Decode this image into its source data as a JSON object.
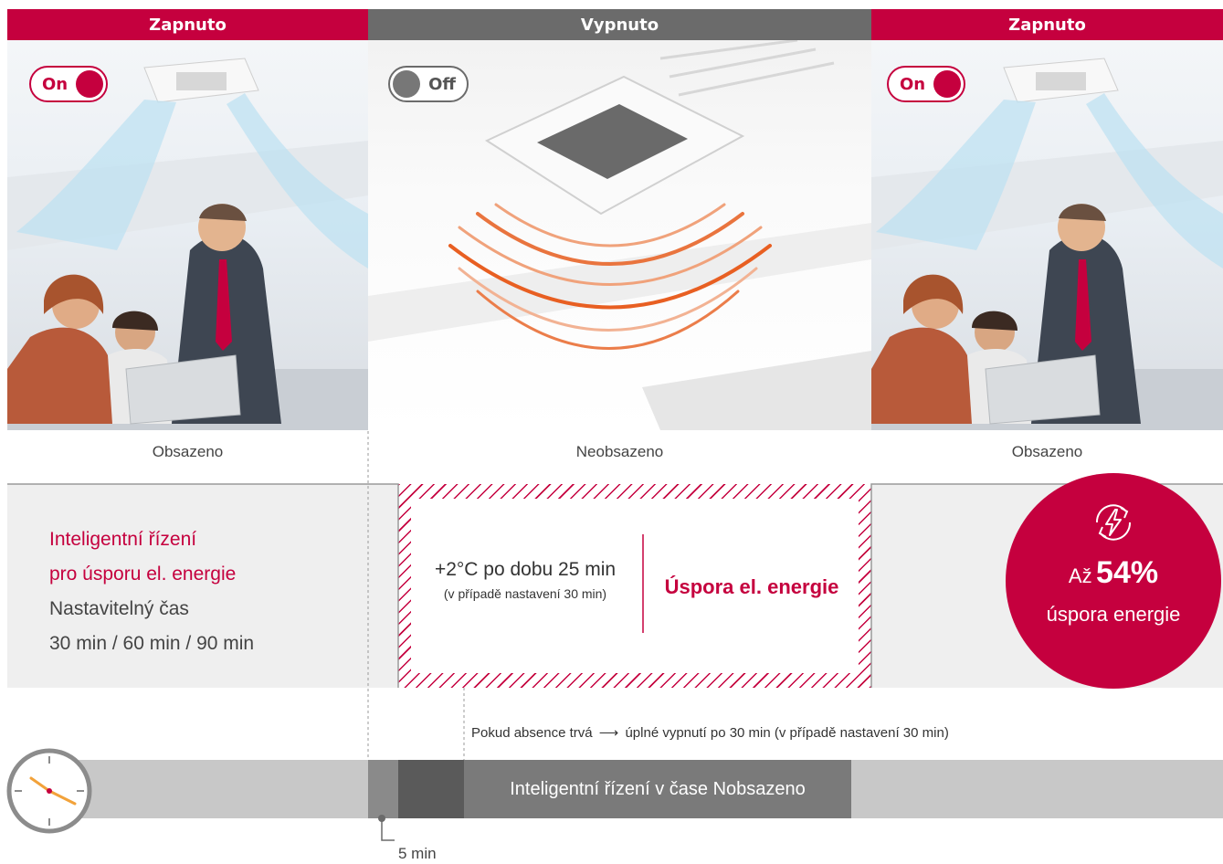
{
  "headers": [
    {
      "label": "Zapnuto",
      "state": "on"
    },
    {
      "label": "Vypnuto",
      "state": "off"
    },
    {
      "label": "Zapnuto",
      "state": "on"
    }
  ],
  "toggles": {
    "left": "On",
    "middle": "Off",
    "right": "On"
  },
  "occupancy": {
    "left": "Obsazeno",
    "middle": "Neobsazeno",
    "right": "Obsazeno"
  },
  "feature": {
    "title_line1": "Inteligentní řízení",
    "title_line2": "pro úsporu el. energie",
    "desc_line1": "Nastavitelný čas",
    "desc_line2": "30 min / 60 min / 90 min"
  },
  "savings_box": {
    "temp_text": "+2°C po dobu 25 min",
    "note": "(v případě nastavení 30 min)",
    "label": "Úspora el. energie"
  },
  "badge": {
    "prefix": "Až",
    "value": "54%",
    "caption": "úspora energie"
  },
  "absence_note": {
    "lead": "Pokud absence trvá",
    "tail": "úplné vypnutí po 30 min (v případě nastavení 30 min)"
  },
  "timeline": {
    "bar_label": "Inteligentní řízení v čase Nobsazeno",
    "marker_label": "5 min"
  },
  "colors": {
    "accent": "#c5003e",
    "grey_header": "#6b6b6b",
    "band_bg": "#efefef",
    "timeline_bg": "#c8c8c8",
    "timeline_dark": "#5a5a5a"
  }
}
